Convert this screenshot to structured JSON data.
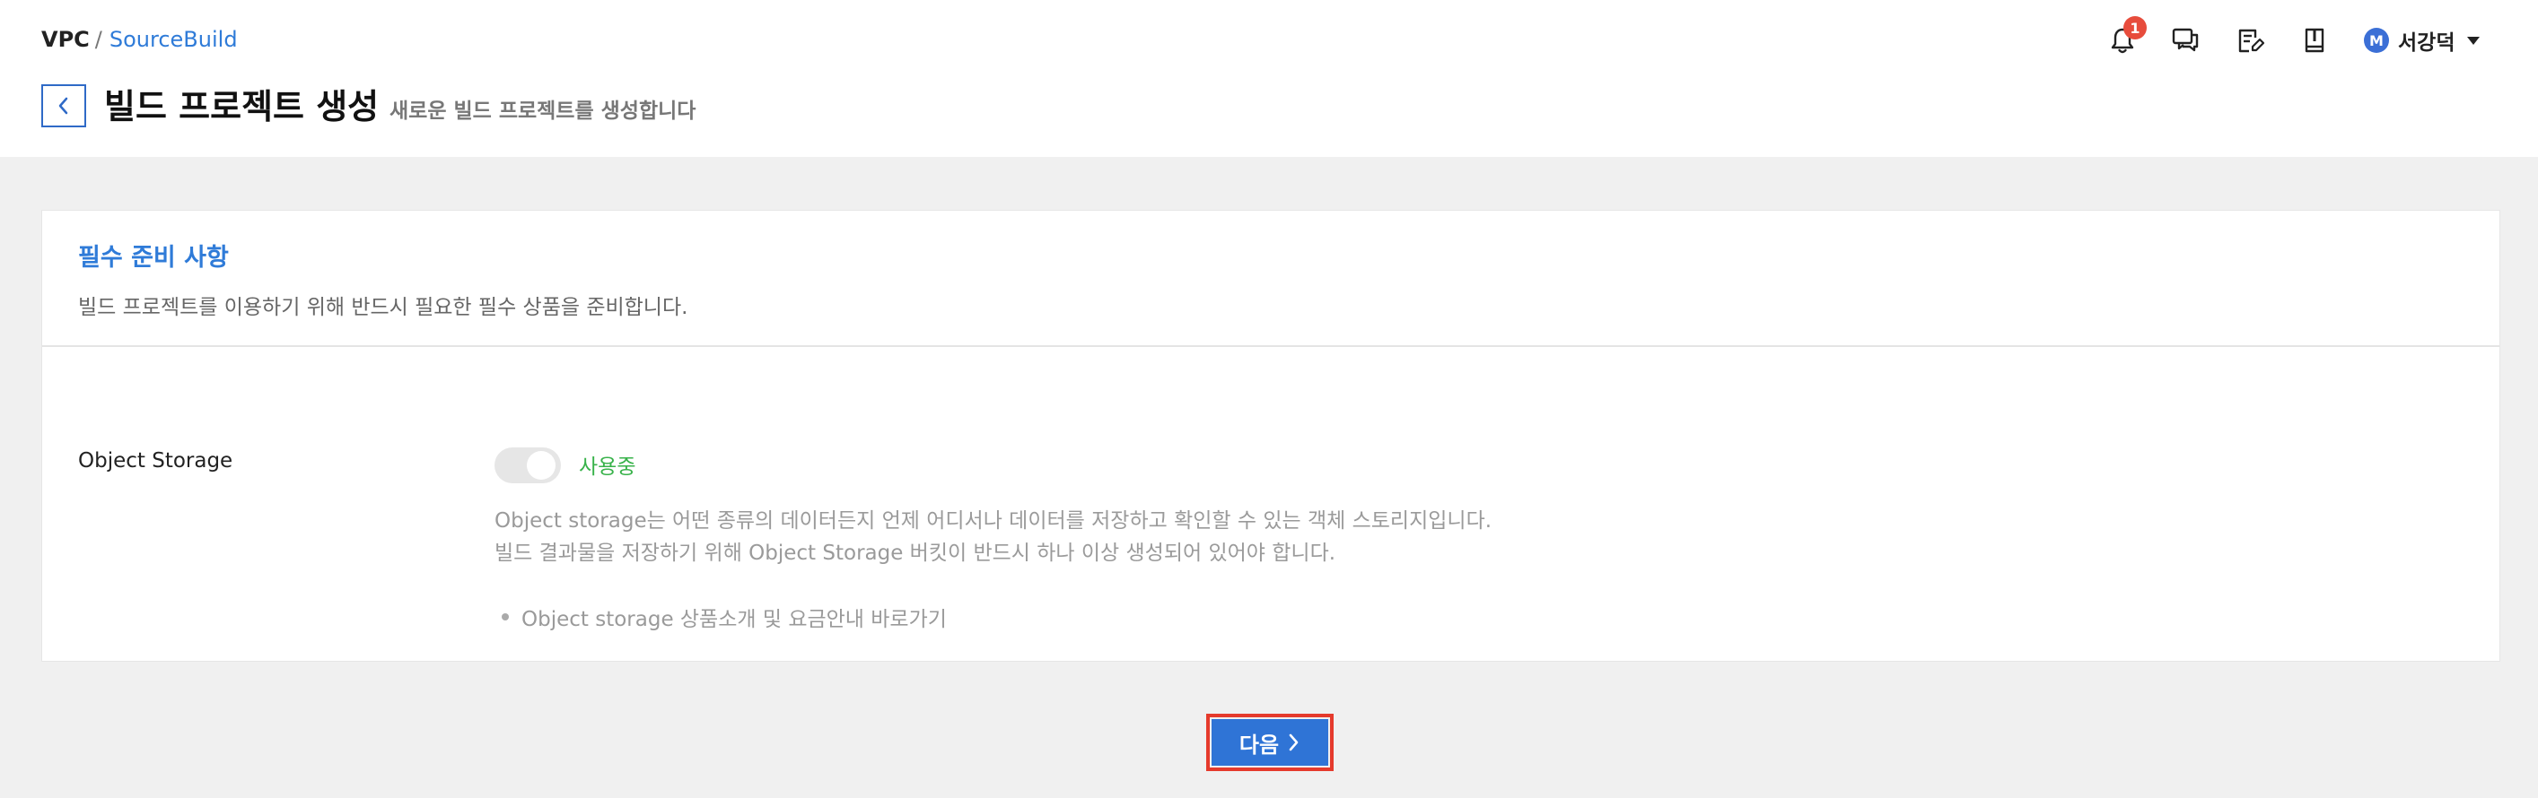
{
  "breadcrumb": {
    "root": "VPC",
    "separator": "/",
    "current": "SourceBuild"
  },
  "page": {
    "title": "빌드 프로젝트 생성",
    "subtitle": "새로운 빌드 프로젝트를 생성합니다"
  },
  "header": {
    "notifications": {
      "icon": "bell-icon",
      "count": "1"
    },
    "icons": [
      "chat-icon",
      "edit-note-icon",
      "book-icon"
    ],
    "user": {
      "initial": "M",
      "name": "서강덕",
      "dropdown_icon": "caret-down-icon"
    }
  },
  "section": {
    "title": "필수 준비 사항",
    "description": "빌드 프로젝트를 이용하기 위해 반드시 필요한 필수 상품을 준비합니다."
  },
  "object_storage": {
    "label": "Object Storage",
    "toggle_on": true,
    "status": "사용중",
    "info_line_1": "Object storage는 어떤 종류의 데이터든지 언제 어디서나 데이터를 저장하고 확인할 수 있는 객체 스토리지입니다.",
    "info_line_2": "빌드 결과물을 저장하기 위해 Object Storage 버킷이 반드시 하나 이상 생성되어 있어야 합니다.",
    "link": "Object storage 상품소개 및 요금안내 바로가기"
  },
  "footer": {
    "next_label": "다음"
  },
  "colors": {
    "accent": "#2f7bd8",
    "status_green": "#38b24a",
    "badge_red": "#e74c3c",
    "highlight_border": "#e53a2c"
  }
}
